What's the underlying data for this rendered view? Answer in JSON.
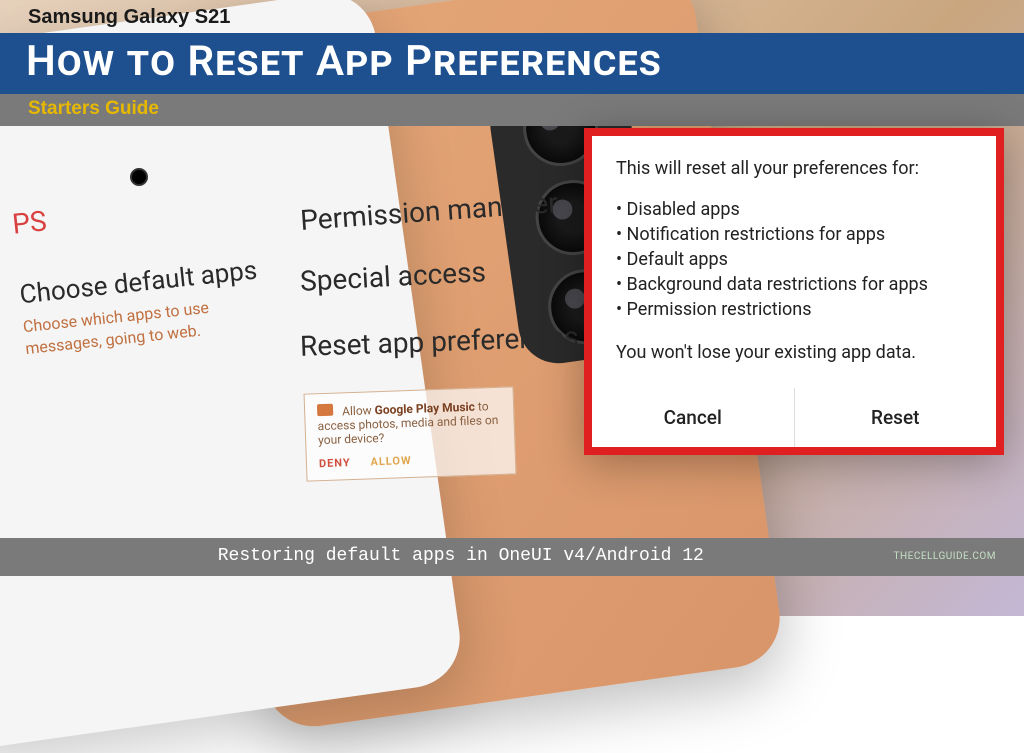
{
  "header": {
    "device": "Samsung Galaxy S21",
    "title": "How to Reset App Preferences",
    "subtitle": "Starters Guide"
  },
  "footer": {
    "text": "Restoring default apps in OneUI v4/Android 12",
    "site": "THECELLGUIDE.COM"
  },
  "settings": {
    "item1": "Permission manager",
    "item2": "Special access",
    "item3": "Reset app preferences"
  },
  "left": {
    "ps": "PS",
    "choose_title": "Choose default apps",
    "choose_sub1": "Choose which apps to use",
    "choose_sub2": "messages, going to web."
  },
  "perm": {
    "line1a": "Allow ",
    "line1b": "Google Play Music",
    "line1c": " to access photos, media and files on your device?",
    "deny": "DENY",
    "allow": "ALLOW"
  },
  "dialog": {
    "intro": "This will reset all your preferences for:",
    "items": [
      "Disabled apps",
      "Notification restrictions for apps",
      "Default apps",
      "Background data restrictions for apps",
      "Permission restrictions"
    ],
    "note": "You won't lose your existing app data.",
    "cancel": "Cancel",
    "reset": "Reset"
  }
}
